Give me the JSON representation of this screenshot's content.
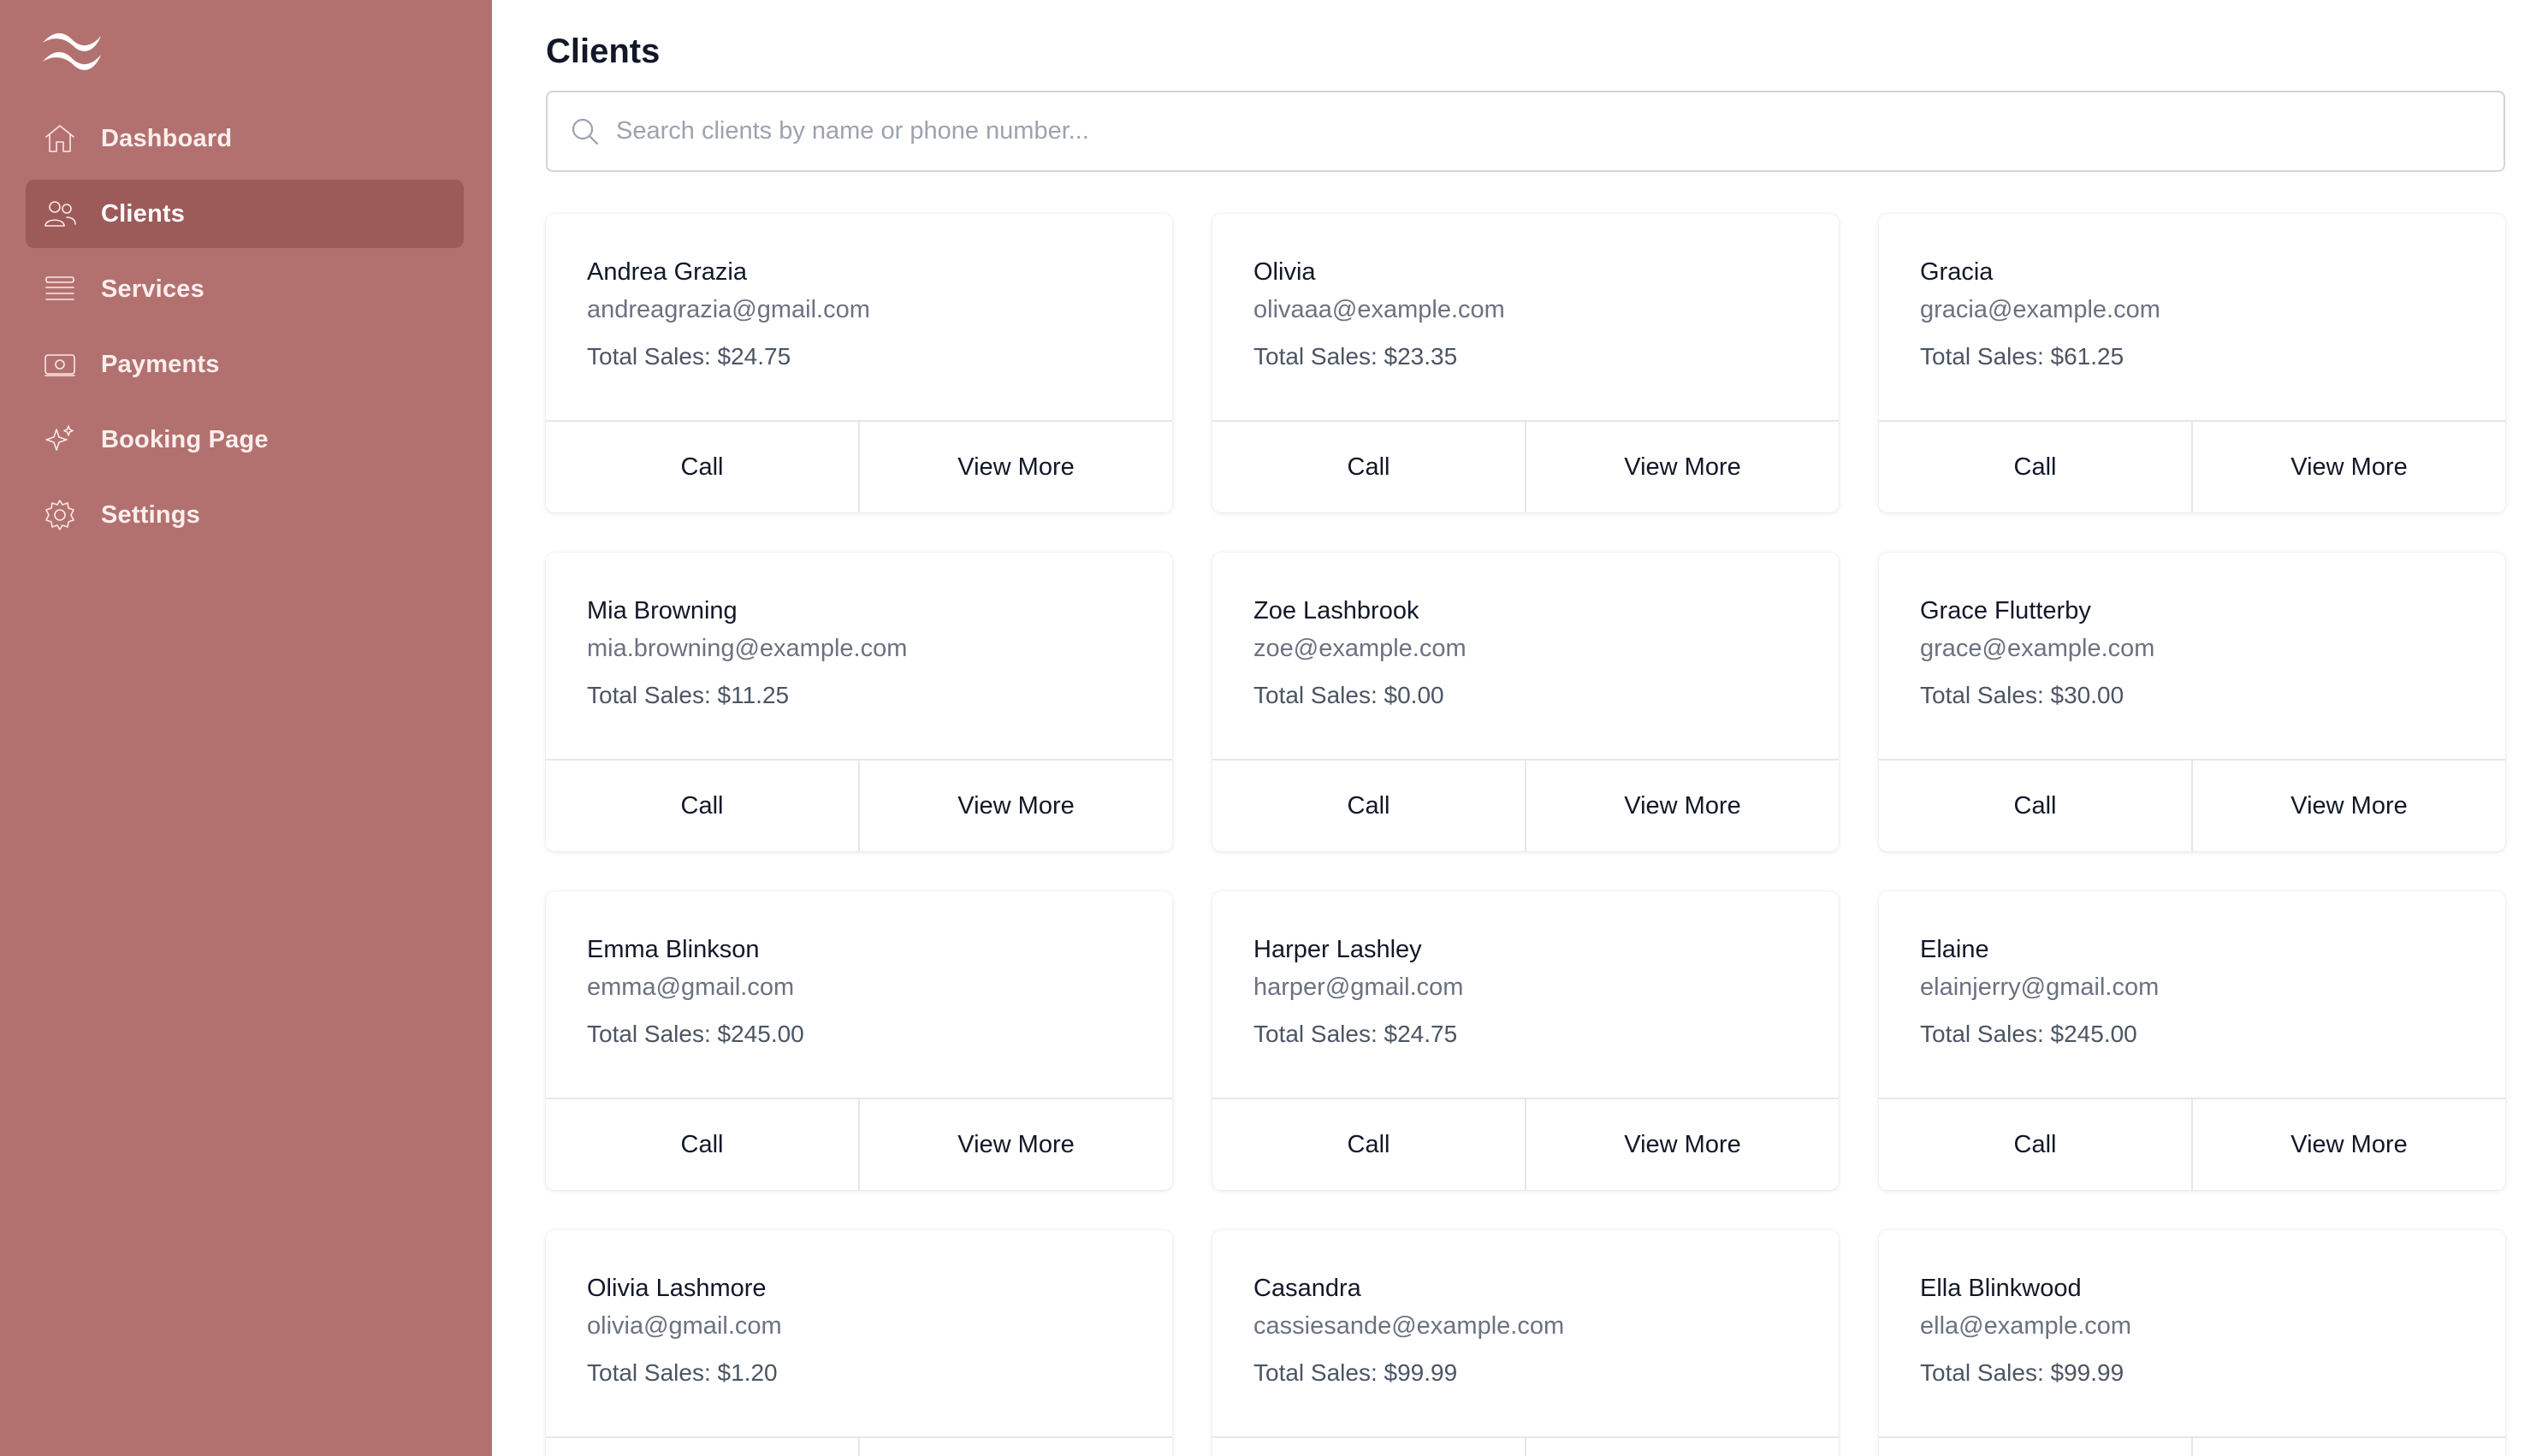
{
  "colors": {
    "sidebar_bg": "#b2716f",
    "sidebar_active": "#9a5a59",
    "accent_text": "#ffffff"
  },
  "sidebar": {
    "logo_icon": "wave-logo-icon",
    "items": [
      {
        "label": "Dashboard",
        "icon": "home-icon",
        "active": false
      },
      {
        "label": "Clients",
        "icon": "users-icon",
        "active": true
      },
      {
        "label": "Services",
        "icon": "list-icon",
        "active": false
      },
      {
        "label": "Payments",
        "icon": "banknote-icon",
        "active": false
      },
      {
        "label": "Booking Page",
        "icon": "sparkles-icon",
        "active": false
      },
      {
        "label": "Settings",
        "icon": "gear-icon",
        "active": false
      }
    ]
  },
  "main": {
    "title": "Clients",
    "search": {
      "placeholder": "Search clients by name or phone number...",
      "value": ""
    },
    "card_actions": {
      "call_label": "Call",
      "view_more_label": "View More"
    },
    "clients": [
      {
        "name": "Andrea Grazia",
        "email": "andreagrazia@gmail.com",
        "total_sales": "Total Sales: $24.75"
      },
      {
        "name": "Olivia",
        "email": "olivaaa@example.com",
        "total_sales": "Total Sales: $23.35"
      },
      {
        "name": "Gracia",
        "email": "gracia@example.com",
        "total_sales": "Total Sales: $61.25"
      },
      {
        "name": "Mia Browning",
        "email": "mia.browning@example.com",
        "total_sales": "Total Sales: $11.25"
      },
      {
        "name": "Zoe Lashbrook",
        "email": "zoe@example.com",
        "total_sales": "Total Sales: $0.00"
      },
      {
        "name": "Grace Flutterby",
        "email": "grace@example.com",
        "total_sales": "Total Sales: $30.00"
      },
      {
        "name": "Emma Blinkson",
        "email": "emma@gmail.com",
        "total_sales": "Total Sales: $245.00"
      },
      {
        "name": "Harper Lashley",
        "email": "harper@gmail.com",
        "total_sales": "Total Sales: $24.75"
      },
      {
        "name": "Elaine",
        "email": "elainjerry@gmail.com",
        "total_sales": "Total Sales: $245.00"
      },
      {
        "name": "Olivia Lashmore",
        "email": "olivia@gmail.com",
        "total_sales": "Total Sales: $1.20"
      },
      {
        "name": "Casandra",
        "email": "cassiesande@example.com",
        "total_sales": "Total Sales: $99.99"
      },
      {
        "name": "Ella Blinkwood",
        "email": "ella@example.com",
        "total_sales": "Total Sales: $99.99"
      }
    ]
  }
}
